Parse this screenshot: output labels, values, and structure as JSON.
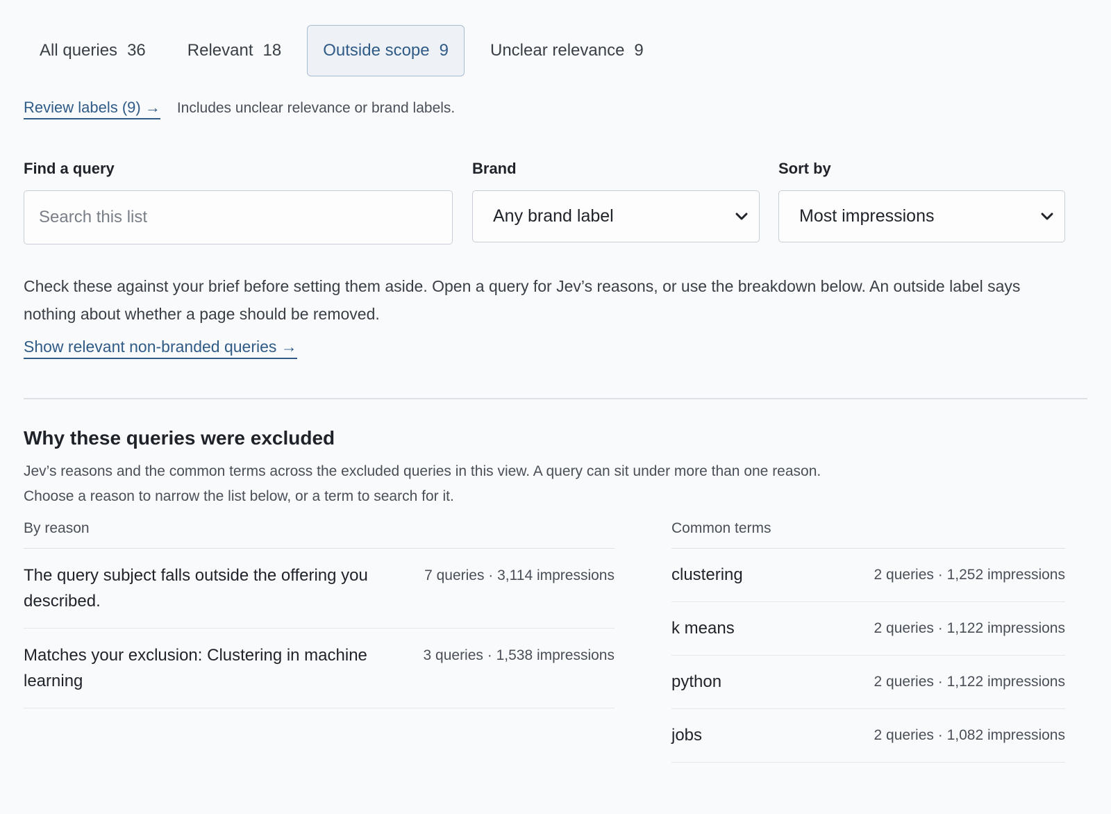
{
  "tabs": [
    {
      "label": "All queries",
      "count": "36"
    },
    {
      "label": "Relevant",
      "count": "18"
    },
    {
      "label": "Outside scope",
      "count": "9"
    },
    {
      "label": "Unclear relevance",
      "count": "9"
    }
  ],
  "active_tab": 2,
  "review": {
    "link_label": "Review labels (9) →",
    "note": "Includes unclear relevance or brand labels."
  },
  "filters": {
    "search_label": "Find a query",
    "search_placeholder": "Search this list",
    "brand_label": "Brand",
    "brand_value": "Any brand label",
    "sort_label": "Sort by",
    "sort_value": "Most impressions"
  },
  "description": "Check these against your brief before setting them aside. Open a query for Jev’s reasons, or use the breakdown below. An outside label says nothing about whether a page should be removed.",
  "show_link": "Show relevant non-branded queries →",
  "exclusion": {
    "title": "Why these queries were excluded",
    "subtitle": "Jev’s reasons and the common terms across the excluded queries in this view. A query can sit under more than one reason. Choose a reason to narrow the list below, or a term to search for it.",
    "by_reason_label": "By reason",
    "common_terms_label": "Common terms",
    "reasons": [
      {
        "label": "The query subject falls outside the offering you described.",
        "meta": "7 queries · 3,114 impressions"
      },
      {
        "label": "Matches your exclusion: Clustering in machine learning",
        "meta": "3 queries · 1,538 impressions"
      }
    ],
    "terms": [
      {
        "label": "clustering",
        "meta": "2 queries · 1,252 impressions"
      },
      {
        "label": "k means",
        "meta": "2 queries · 1,122 impressions"
      },
      {
        "label": "python",
        "meta": "2 queries · 1,122 impressions"
      },
      {
        "label": "jobs",
        "meta": "2 queries · 1,082 impressions"
      }
    ]
  },
  "colors": {
    "accent": "#2f5b86",
    "active_tab_bg": "#eef2f7",
    "active_tab_border": "#a9bccf"
  },
  "icons": {
    "select_chevron": "chevron-down-icon"
  }
}
